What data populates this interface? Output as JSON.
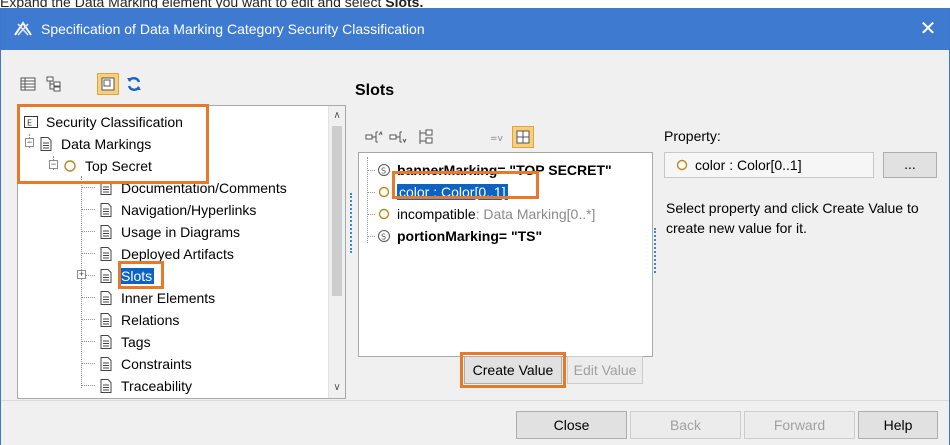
{
  "caption": {
    "prefix": "Expand the Data Marking element you want to edit and select ",
    "emphasis": "Slots."
  },
  "window": {
    "title": "Specification of Data Marking Category Security Classification",
    "app_icon": "magicdraw-icon",
    "close_label": "✕"
  },
  "left_toolbar": [
    {
      "icon": "table-view-icon"
    },
    {
      "icon": "tree-view-icon"
    },
    {
      "icon": "compact-view-icon",
      "active": true
    },
    {
      "icon": "refresh-icon"
    }
  ],
  "tree": {
    "items": [
      {
        "label": "Security Classification",
        "icon": "enumeration-icon"
      },
      {
        "label": "Data Markings",
        "icon": "document-icon"
      },
      {
        "label": "Top Secret",
        "icon": "instance-icon"
      },
      {
        "label": "Documentation/Comments",
        "icon": "document-icon"
      },
      {
        "label": "Navigation/Hyperlinks",
        "icon": "document-icon"
      },
      {
        "label": "Usage in Diagrams",
        "icon": "document-icon"
      },
      {
        "label": "Deployed Artifacts",
        "icon": "document-icon"
      },
      {
        "label": "Slots",
        "icon": "document-icon",
        "selected": true
      },
      {
        "label": "Inner Elements",
        "icon": "document-icon"
      },
      {
        "label": "Relations",
        "icon": "document-icon"
      },
      {
        "label": "Tags",
        "icon": "document-icon"
      },
      {
        "label": "Constraints",
        "icon": "document-icon"
      },
      {
        "label": "Traceability",
        "icon": "document-icon"
      }
    ]
  },
  "slots": {
    "title": "Slots",
    "toolbar": [
      {
        "icon": "expand-all-icon"
      },
      {
        "icon": "collapse-all-icon"
      },
      {
        "icon": "hierarchy-icon"
      },
      {
        "icon": "show-values-icon"
      },
      {
        "icon": "grid-view-icon",
        "active": true
      }
    ],
    "rows": [
      {
        "name": "bannerMarking",
        "value": " = \"TOP SECRET\"",
        "icon": "slot-icon"
      },
      {
        "name": "color : Color[0..1]",
        "icon": "property-icon",
        "selected": true
      },
      {
        "name": "incompatible",
        "type": " : Data Marking[0..*]",
        "icon": "property-icon"
      },
      {
        "name": "portionMarking",
        "value": " = \"TS\"",
        "icon": "slot-icon"
      }
    ],
    "create_value_label": "Create Value",
    "edit_value_label": "Edit Value"
  },
  "property": {
    "label": "Property:",
    "value": "color : Color[0..1]",
    "more_label": "...",
    "hint": "Select property and click Create Value to create new value for it."
  },
  "footer": {
    "close_label": "Close",
    "back_label": "Back",
    "forward_label": "Forward",
    "help_label": "Help"
  },
  "colors": {
    "titlebar": "#3e7bd0",
    "selection": "#0b63c4",
    "highlight": "#e8792b"
  }
}
